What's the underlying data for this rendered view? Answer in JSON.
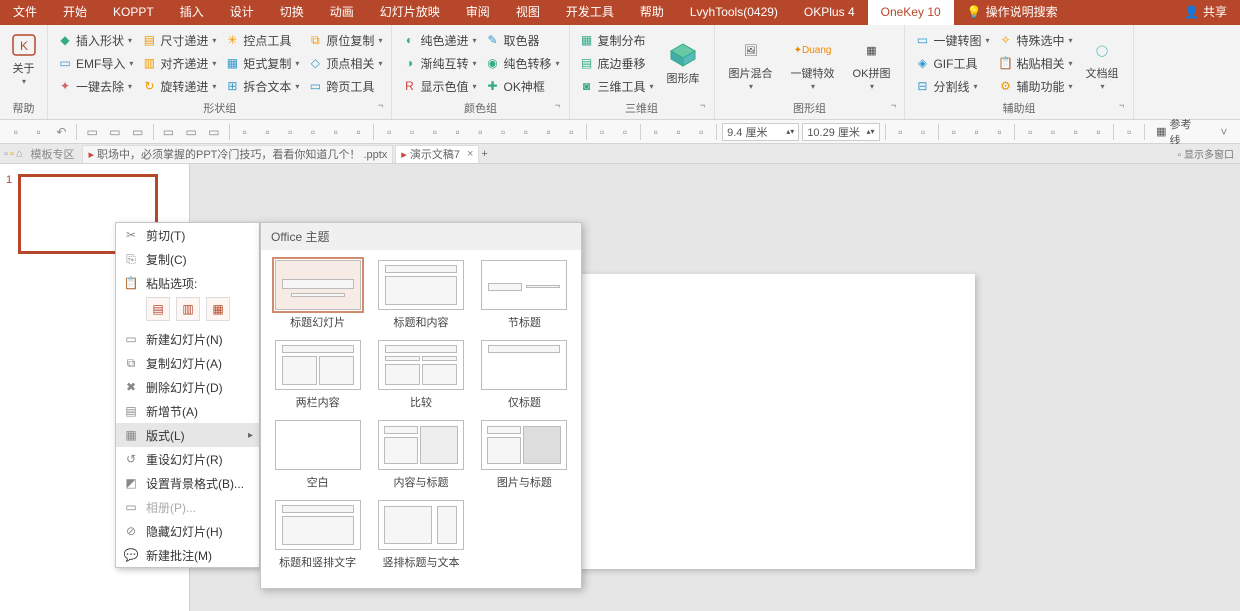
{
  "menu": {
    "items": [
      "文件",
      "开始",
      "KOPPT",
      "插入",
      "设计",
      "切换",
      "动画",
      "幻灯片放映",
      "审阅",
      "视图",
      "开发工具",
      "帮助",
      "LvyhTools(0429)",
      "OKPlus 4",
      "OneKey 10"
    ],
    "active": 14,
    "tell_me": "操作说明搜索",
    "share": "共享"
  },
  "ribbon": {
    "help": {
      "about": "关于",
      "label": "帮助"
    },
    "shape_group": {
      "label": "形状组",
      "c1": [
        "插入形状",
        "EMF导入",
        "一键去除"
      ],
      "c2": [
        "尺寸递进",
        "对齐递进",
        "旋转递进"
      ],
      "c3": [
        "控点工具",
        "矩式复制",
        "拆合文本"
      ],
      "c4": [
        "原位复制",
        "顶点相关",
        "跨页工具"
      ]
    },
    "color_group": {
      "label": "颜色组",
      "c1": [
        "纯色递进",
        "渐纯互转",
        "显示色值"
      ],
      "c2": [
        "取色器",
        "纯色转移",
        "OK神框"
      ]
    },
    "three_group": {
      "label": "三维组",
      "items": [
        "复制分布",
        "底边垂移",
        "三维工具"
      ],
      "lib": "图形库"
    },
    "image_group": {
      "label": "图形组",
      "a": "图片混合",
      "b": "一键特效",
      "c": "OK拼图"
    },
    "aux_group": {
      "label": "辅助组",
      "c1": [
        "一键转图",
        "GIF工具",
        "分割线"
      ],
      "c2": [
        "特殊选中",
        "粘贴相关",
        "辅助功能"
      ],
      "doc": "文档组"
    }
  },
  "qat": {
    "dim1": "9.4 厘米",
    "dim2": "10.29 厘米",
    "reflines": "参考线"
  },
  "tabs": {
    "crumb": "模板专区",
    "t1": "职场中，必须掌握的PPT冷门技巧，看看你知道几个！ .pptx",
    "t2": "演示文稿7",
    "footer": "显示多窗口"
  },
  "slide_num": "1",
  "ctx": {
    "cut": "剪切(T)",
    "copy": "复制(C)",
    "paste_hdr": "粘贴选项:",
    "new": "新建幻灯片(N)",
    "dup": "复制幻灯片(A)",
    "del": "删除幻灯片(D)",
    "section": "新增节(A)",
    "layout": "版式(L)",
    "reset": "重设幻灯片(R)",
    "bg": "设置背景格式(B)...",
    "album": "相册(P)...",
    "hide": "隐藏幻灯片(H)",
    "comment": "新建批注(M)"
  },
  "fly": {
    "header": "Office 主题",
    "layouts": [
      "标题幻灯片",
      "标题和内容",
      "节标题",
      "两栏内容",
      "比较",
      "仅标题",
      "空白",
      "内容与标题",
      "图片与标题",
      "标题和竖排文字",
      "竖排标题与文本"
    ]
  }
}
